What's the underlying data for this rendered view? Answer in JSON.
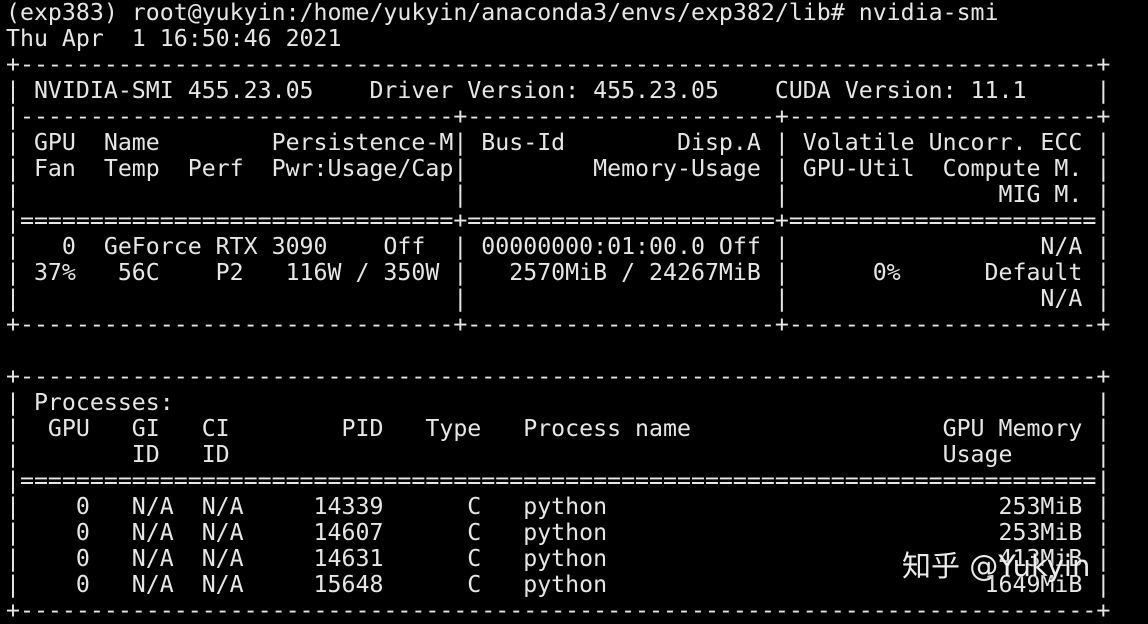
{
  "prompt_line": "(exp383) root@yukyin:/home/yukyin/anaconda3/envs/exp382/lib# nvidia-smi",
  "timestamp_line": "Thu Apr  1 16:50:46 2021",
  "gpu_table": {
    "border_top": "+-----------------------------------------------------------------------------+",
    "version_line": "| NVIDIA-SMI 455.23.05    Driver Version: 455.23.05    CUDA Version: 11.1     |",
    "separator": "|-------------------------------+----------------------+----------------------+",
    "header_line_1": "| GPU  Name        Persistence-M| Bus-Id        Disp.A | Volatile Uncorr. ECC |",
    "header_line_2": "| Fan  Temp  Perf  Pwr:Usage/Cap|         Memory-Usage | GPU-Util  Compute M. |",
    "header_line_3": "|                               |                      |               MIG M. |",
    "double_separator": "|===============================+======================+======================|",
    "gpu_row_1": "|   0  GeForce RTX 3090    Off  | 00000000:01:00.0 Off |                  N/A |",
    "gpu_row_2": "| 37%   56C    P2   116W / 350W |   2570MiB / 24267MiB |      0%      Default |",
    "gpu_row_3": "|                               |                      |                  N/A |",
    "border_bottom": "+-------------------------------+----------------------+----------------------+"
  },
  "process_table": {
    "border_top": "+-----------------------------------------------------------------------------+",
    "title_line": "| Processes:                                                                  |",
    "header_line_1": "|  GPU   GI   CI        PID   Type   Process name                  GPU Memory |",
    "header_line_2": "|        ID   ID                                                   Usage      |",
    "double_separator": "|=============================================================================|",
    "rows": [
      "|    0   N/A  N/A     14339      C   python                            253MiB |",
      "|    0   N/A  N/A     14607      C   python                            253MiB |",
      "|    0   N/A  N/A     14631      C   python                            413MiB |",
      "|    0   N/A  N/A     15648      C   python                           1649MiB |"
    ],
    "border_bottom": "+-----------------------------------------------------------------------------+"
  },
  "watermark": "知乎 @Yukyin"
}
